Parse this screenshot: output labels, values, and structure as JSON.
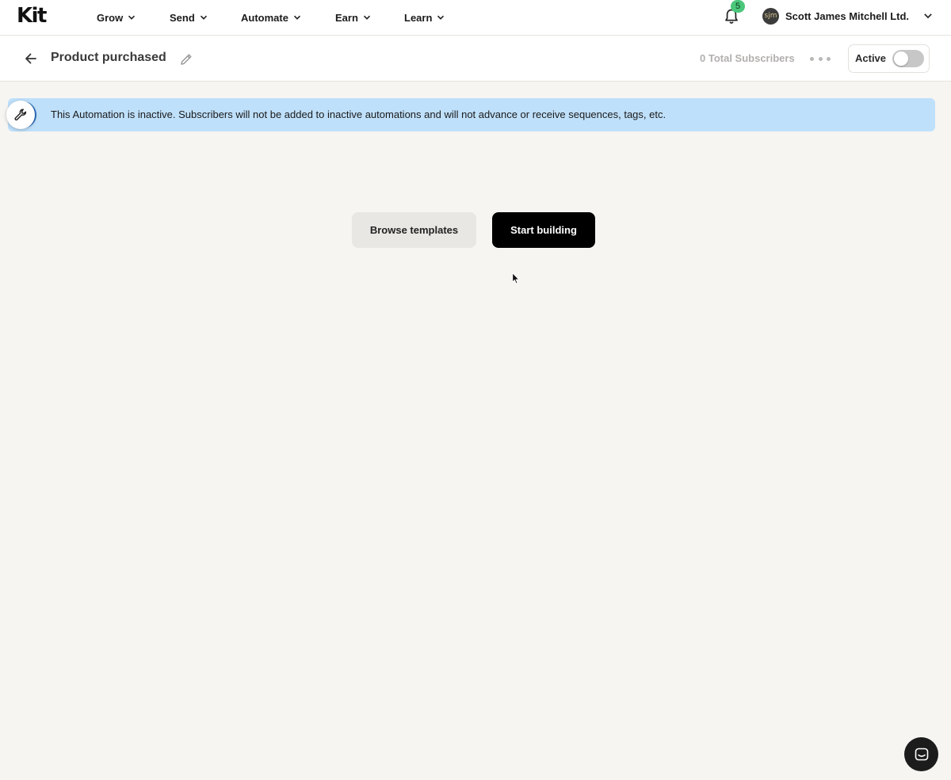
{
  "brand": {
    "logo_text": "Kit"
  },
  "nav": {
    "items": [
      {
        "label": "Grow"
      },
      {
        "label": "Send"
      },
      {
        "label": "Automate"
      },
      {
        "label": "Earn"
      },
      {
        "label": "Learn"
      }
    ],
    "notifications": {
      "count": "5",
      "icon": "bell-icon",
      "badge_color": "#4ac77a"
    },
    "account": {
      "initials": "sjm",
      "name": "Scott James Mitchell Ltd."
    }
  },
  "automation": {
    "title": "Product purchased",
    "subscriber_count": "0 Total Subscribers",
    "active_label": "Active",
    "active": false
  },
  "banner": {
    "text": "This Automation is inactive. Subscribers will not be added to inactive automations and will not advance or receive sequences, tags, etc.",
    "background": "#bfe0fb"
  },
  "actions": {
    "browse_label": "Browse templates",
    "start_label": "Start building"
  },
  "colors": {
    "page_background": "#f6f5f2",
    "primary_button": "#000000",
    "secondary_button": "#e8e7e4"
  }
}
